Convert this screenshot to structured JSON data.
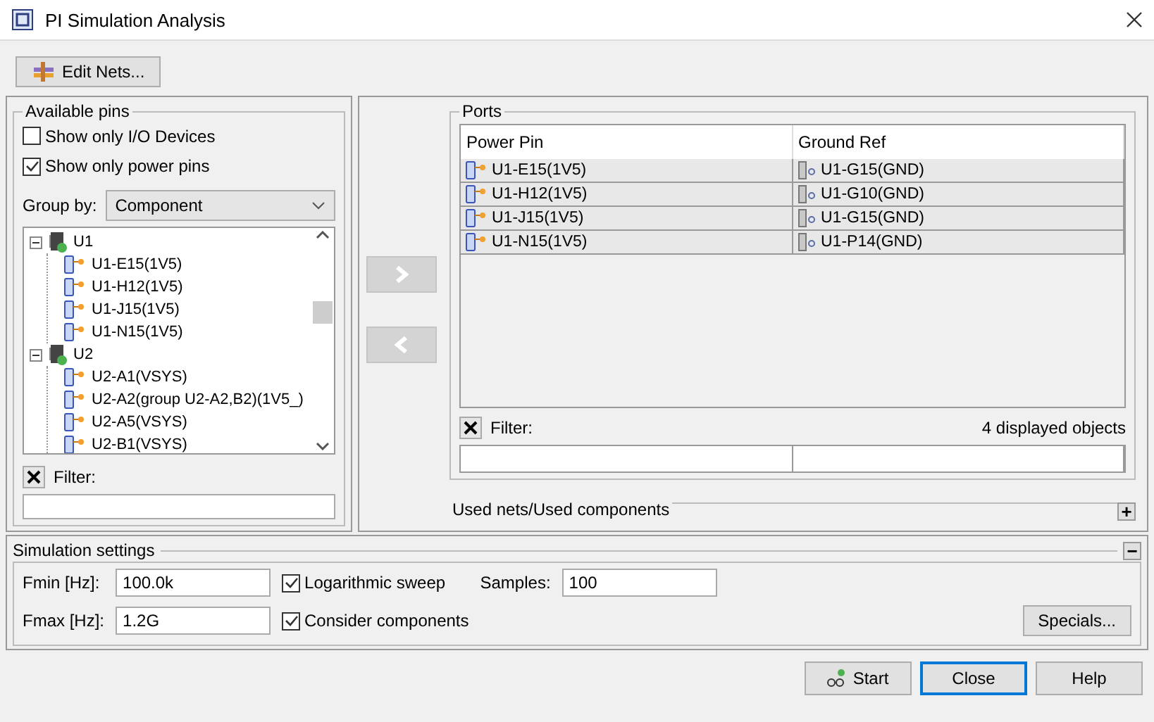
{
  "window": {
    "title": "PI Simulation Analysis"
  },
  "toolbar": {
    "edit_nets_button": "Edit Nets..."
  },
  "available_pins": {
    "title": "Available pins",
    "checkboxes": [
      {
        "label": "Show only I/O Devices",
        "checked": false
      },
      {
        "label": "Show only power pins",
        "checked": true
      }
    ],
    "group_by": {
      "label": "Group by:",
      "value": "Component"
    },
    "tree": [
      {
        "label": "U1",
        "expanded": true,
        "children": [
          {
            "label": "U1-E15(1V5)"
          },
          {
            "label": "U1-H12(1V5)"
          },
          {
            "label": "U1-J15(1V5)"
          },
          {
            "label": "U1-N15(1V5)"
          }
        ]
      },
      {
        "label": "U2",
        "expanded": true,
        "children": [
          {
            "label": "U2-A1(VSYS)"
          },
          {
            "label": "U2-A2(group U2-A2,B2)(1V5_)"
          },
          {
            "label": "U2-A5(VSYS)"
          },
          {
            "label": "U2-B1(VSYS)"
          }
        ]
      }
    ],
    "filter": {
      "label": "Filter:"
    }
  },
  "ports": {
    "title": "Ports",
    "columns": [
      "Power Pin",
      "Ground Ref"
    ],
    "rows": [
      {
        "power_pin": "U1-E15(1V5)",
        "ground_ref": "U1-G15(GND)"
      },
      {
        "power_pin": "U1-H12(1V5)",
        "ground_ref": "U1-G10(GND)"
      },
      {
        "power_pin": "U1-J15(1V5)",
        "ground_ref": "U1-G15(GND)"
      },
      {
        "power_pin": "U1-N15(1V5)",
        "ground_ref": "U1-P14(GND)"
      }
    ],
    "filter": {
      "label": "Filter:"
    },
    "count": "4 displayed objects"
  },
  "used_nets": {
    "title": "Used nets/Used components",
    "toggle": "+"
  },
  "simulation_settings": {
    "title": "Simulation settings",
    "toggle": "−",
    "fmin": {
      "label": "Fmin [Hz]:",
      "value": "100.0k"
    },
    "fmax": {
      "label": "Fmax [Hz]:",
      "value": "1.2G"
    },
    "checkboxes": [
      {
        "label": "Logarithmic sweep",
        "checked": true
      },
      {
        "label": "Consider components",
        "checked": true
      }
    ],
    "samples": {
      "label": "Samples:",
      "value": "100"
    },
    "specials_button": "Specials..."
  },
  "buttons": [
    {
      "label": "Start",
      "kind": "start",
      "focused": false
    },
    {
      "label": "Close",
      "kind": "plain",
      "focused": true
    },
    {
      "label": "Help",
      "kind": "plain",
      "focused": false
    }
  ]
}
